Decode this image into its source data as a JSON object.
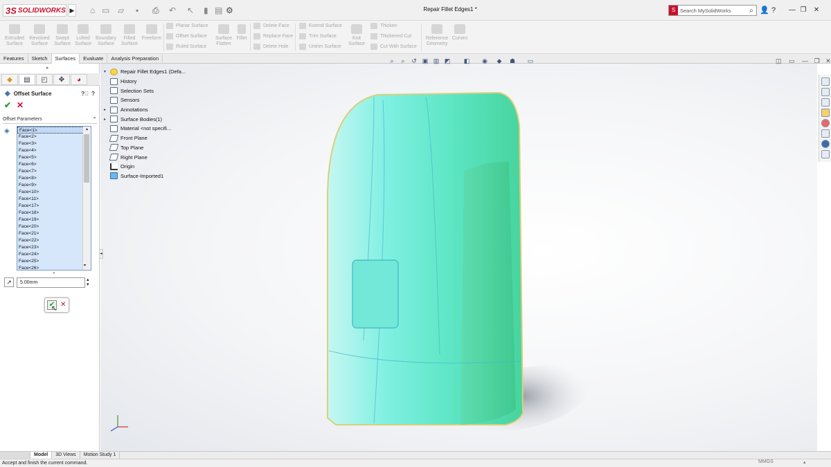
{
  "app": {
    "logo_mark": "3S",
    "logo_text": "SOLIDWORKS",
    "document_title": "Repair Fillet Edges1 *"
  },
  "search": {
    "placeholder": "Search MySolidWorks"
  },
  "ribbon": {
    "buttons": [
      {
        "id": "extruded",
        "label": "Extruded\nSurface"
      },
      {
        "id": "revolved",
        "label": "Revolved\nSurface"
      },
      {
        "id": "swept",
        "label": "Swept\nSurface"
      },
      {
        "id": "lofted",
        "label": "Lofted\nSurface"
      },
      {
        "id": "boundary",
        "label": "Boundary\nSurface"
      },
      {
        "id": "filled",
        "label": "Filled\nSurface"
      },
      {
        "id": "freeform",
        "label": "Freeform"
      }
    ],
    "group1": [
      "Planar Surface",
      "Offset Surface",
      "Ruled Surface"
    ],
    "flatten": "Surface\nFlatten",
    "fillet": "Fillet",
    "group2": [
      "Delete Face",
      "Replace Face",
      "Delete Hole"
    ],
    "group3": [
      "Extend Surface",
      "Trim Surface",
      "Untrim Surface"
    ],
    "knit": "Knit\nSurface",
    "group4": [
      "Thicken",
      "Thickened Cut",
      "Cut With Surface"
    ],
    "refgeom": "Reference\nGeometry",
    "curves": "Curves"
  },
  "command_tabs": [
    "Features",
    "Sketch",
    "Surfaces",
    "Evaluate",
    "Analysis Preparation"
  ],
  "property_manager": {
    "title": "Offset Surface",
    "section": "Offset Parameters",
    "faces": [
      "Face<1>",
      "Face<2>",
      "Face<3>",
      "Face<4>",
      "Face<5>",
      "Face<6>",
      "Face<7>",
      "Face<8>",
      "Face<9>",
      "Face<10>",
      "Face<11>",
      "Face<17>",
      "Face<18>",
      "Face<19>",
      "Face<20>",
      "Face<21>",
      "Face<22>",
      "Face<23>",
      "Face<24>",
      "Face<25>",
      "Face<26>"
    ],
    "distance": "5.00mm"
  },
  "tree": {
    "root": "Repair Fillet Edges1  (Defa...",
    "items": [
      {
        "label": "History",
        "expand": ""
      },
      {
        "label": "Selection Sets",
        "expand": ""
      },
      {
        "label": "Sensors",
        "expand": ""
      },
      {
        "label": "Annotations",
        "expand": "▸"
      },
      {
        "label": "Surface Bodies(1)",
        "expand": "▸"
      },
      {
        "label": "Material <not specifi...",
        "expand": ""
      },
      {
        "label": "Front Plane",
        "expand": ""
      },
      {
        "label": "Top Plane",
        "expand": ""
      },
      {
        "label": "Right Plane",
        "expand": ""
      },
      {
        "label": "Origin",
        "expand": ""
      },
      {
        "label": "Surface-Imported1",
        "expand": ""
      }
    ]
  },
  "bottom_tabs": [
    "Model",
    "3D Views",
    "Motion Study 1"
  ],
  "status": {
    "message": "Accept and finish the current command.",
    "units": "MMGS"
  }
}
